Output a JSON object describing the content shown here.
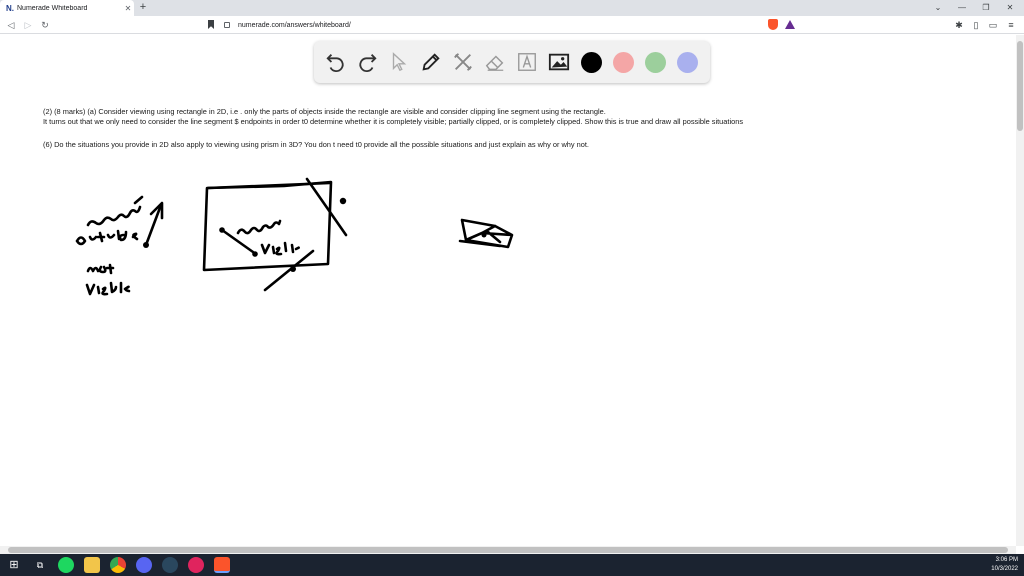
{
  "browser": {
    "tab": {
      "title": "Numerade Whiteboard",
      "favicon": "N."
    },
    "url": "numerade.com/answers/whiteboard/"
  },
  "whiteboard": {
    "colors": [
      "#000000",
      "#f4a6a6",
      "#9ccf9c",
      "#a9b0ee"
    ],
    "question_lines": [
      "(2) (8 marks) (a) Consider viewing using rectangle in 2D, i.e . only the parts of objects inside the rectangle are visible and consider clipping line segment using the rectangle.",
      "It turns out that we only need to consider the line segment $ endpoints in order t0 determine whether it is completely visible; partially clipped, or is completely clipped. Show this is true and draw all possible situations",
      "(6) Do the situations you provide in 2D also apply to viewing using prism in 3D? You don t need t0 provide all the possible situations and just explain as why or why not."
    ]
  },
  "taskbar": {
    "time": "3:06 PM",
    "date": "10/3/2022"
  }
}
